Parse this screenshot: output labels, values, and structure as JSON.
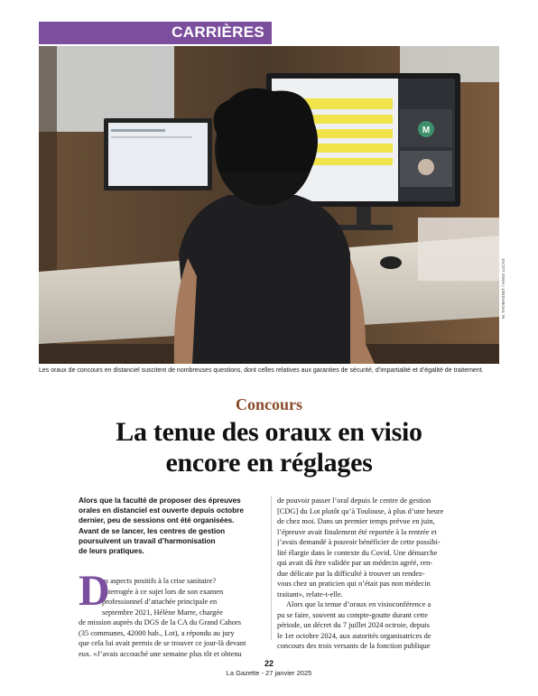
{
  "rubric": "CARRIÈRES",
  "photo": {
    "credit": "M. THOMASSET / HANS LUCAS",
    "monitor_avatar_letter": "M",
    "colors": {
      "wall": "#5a4330",
      "desk": "#d9d3c8",
      "screen_yellow": "#f0e44a",
      "person": "#1f1f22"
    }
  },
  "caption": "Les oraux de concours en distanciel suscitent de nombreuses questions, dont celles relatives aux garanties de sécurité, d’impartialité et d’égalité de traitement.",
  "kicker": "Concours",
  "headline": {
    "line1": "La tenue des oraux en visio",
    "line2": "encore en réglages"
  },
  "chapo": {
    "l1": "Alors que la faculté de proposer des épreuves",
    "l2": "orales en distanciel est ouverte depuis octobre",
    "l3": "dernier, peu de sessions ont été organisées.",
    "l4": "Avant de se lancer, les centres de gestion",
    "l5": "poursuivent un travail d’harmonisation",
    "l6": "de leurs pratiques."
  },
  "body_left": {
    "dropcap": "D",
    "l1": "es aspects positifs à la crise sanitaire?",
    "l2": "Interrogée à ce sujet lors de son examen",
    "l3": "professionnel d’attachée principale en",
    "l4": "septembre 2021, Hélène Marre, chargée",
    "l5": "de mission auprès du DGS de la CA du Grand Cahors",
    "l6": "(35 communes, 42000 hab., Lot), a répondu au jury",
    "l7": "que cela lui avait permis de se trouver ce jour-là devant",
    "l8": "eux. «J’avais accouché une semaine plus tôt et obtenu"
  },
  "body_right": {
    "l1": "de pouvoir passer l’oral depuis le centre de gestion",
    "l2": "[CDG] du Lot plutôt qu’à Toulouse, à plus d’une heure",
    "l3": "de chez moi. Dans un premier temps prévue en juin,",
    "l4": "l’épreuve avait finalement été reportée à la rentrée et",
    "l5": "j’avais demandé à pouvoir bénéficier de cette possibi-",
    "l6": "lité élargie dans le contexte du Covid. Une démarche",
    "l7": "qui avait dû être validée par un médecin agréé, ren-",
    "l8": "due délicate par la difficulté à trouver un rendez-",
    "l9": "vous chez un praticien qui n’était pas non médecin",
    "l10": "traitant», relate-t-elle.",
    "l11": "Alors que la tenue d’oraux en visioconférence a",
    "l12": "pu se faire, souvent au compte-goutte durant cette",
    "l13": "période, un décret du 7 juillet 2024 octroie, depuis",
    "l14": "le 1er octobre 2024, aux autorités organisatrices de",
    "l15": "concours des trois versants de la fonction publique"
  },
  "footer": {
    "page_number": "22",
    "issue": "La Gazette - 27 janvier 2025"
  }
}
